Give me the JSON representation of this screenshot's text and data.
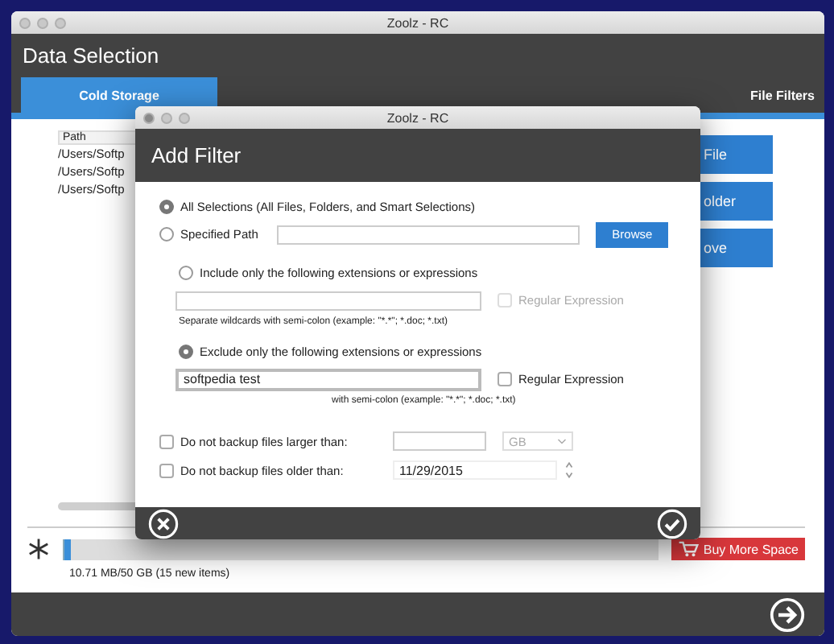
{
  "main_window": {
    "title": "Zoolz - RC",
    "heading": "Data Selection",
    "tabs": [
      {
        "label": "Cold Storage",
        "selected": true
      },
      {
        "label": "File Filters",
        "selected": false
      }
    ],
    "path_list": {
      "header": "Path",
      "rows": [
        "/Users/Softp",
        "/Users/Softp",
        "/Users/Softp"
      ]
    },
    "buttons": [
      "File",
      "older",
      "ove"
    ],
    "storage": {
      "level": 0.01,
      "usage": "10.71 MB/50 GB (15 new items)",
      "buy_button": "Buy More Space"
    }
  },
  "dialog": {
    "title": "Zoolz - RC",
    "heading": "Add Filter",
    "scope_options": [
      {
        "label": "All Selections (All Files, Folders, and Smart Selections)",
        "selected": true
      },
      {
        "label": "Specified Path",
        "selected": false
      }
    ],
    "browse_button": "Browse",
    "filter_options": [
      {
        "label": "Include only the following extensions or expressions",
        "selected": false,
        "regex_label": "Regular Expression",
        "regex_checked": false,
        "regex_disabled": true,
        "hint": "Separate wildcards with semi-colon (example: \"*.*\"; *.doc; *.txt)"
      },
      {
        "label": "Exclude only the following extensions or expressions",
        "selected": true,
        "value": "softpedia test",
        "regex_label": "Regular Expression",
        "regex_checked": false,
        "regex_disabled": false,
        "hint": "with semi-colon (example: \"*.*\"; *.doc; *.txt)"
      }
    ],
    "limits": [
      {
        "kind": "size",
        "label": "Do not backup files larger than:",
        "checked": false,
        "unit": "GB"
      },
      {
        "kind": "date",
        "label": "Do not backup files older than:",
        "checked": false,
        "value": "11/29/2015"
      }
    ]
  }
}
